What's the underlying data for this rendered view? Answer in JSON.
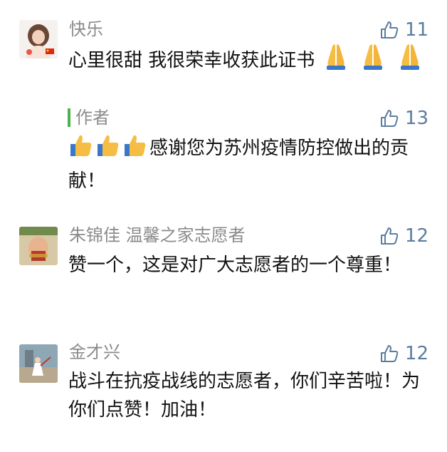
{
  "comments": [
    {
      "name": "快乐",
      "text_before_emoji": "心里很甜  我很荣幸收获此证书",
      "emoji_prayer": "🙏",
      "likes": "11",
      "reply": {
        "label": "作者",
        "emoji_thumb": "👍",
        "text": "感谢您为苏州疫情防控做出的贡献！",
        "likes": "13"
      }
    },
    {
      "name": "朱锦佳 温馨之家志愿者",
      "text": "赞一个，这是对广大志愿者的一个尊重！",
      "likes": "12"
    },
    {
      "name": "金才兴",
      "text": "战斗在抗疫战线的志愿者，你们辛苦啦！为你们点赞！加油！",
      "likes": "12"
    }
  ],
  "colors": {
    "name": "#8b8b8b",
    "text": "#111111",
    "like": "#5b7d9f",
    "author_bar": "#4bb34b"
  },
  "icons": {
    "like": "thumbs-up-outline-icon",
    "prayer": "folded-hands-emoji",
    "thumb": "thumbs-up-emoji"
  }
}
